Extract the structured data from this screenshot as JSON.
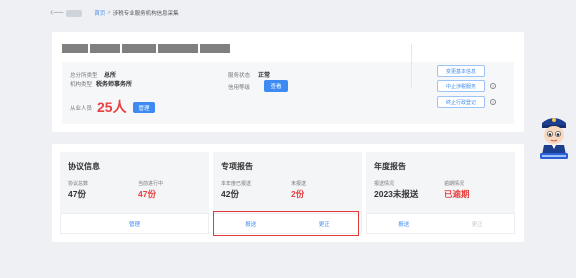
{
  "topbar": {
    "back_icon": "‹—",
    "breadcrumb_home": "首页",
    "breadcrumb_sep": ">",
    "breadcrumb_current": "涉税专业服务机构信息采集"
  },
  "org": {
    "type_label": "总分所类型",
    "type_value": "总所",
    "kind_label": "机构类型",
    "kind_value": "税务师事务所",
    "staff_label": "从业人员",
    "staff_value": "25人",
    "manage_button": "管理",
    "service_status_label": "服务状态",
    "service_status_value": "正常",
    "credit_label": "信用等级",
    "view_button": "查看",
    "actions": [
      "变更基本信息",
      "中止涉税服务",
      "终止行政登记"
    ]
  },
  "panels": {
    "agreement": {
      "title": "协议信息",
      "total_label": "协议总数",
      "total_value": "47份",
      "ongoing_label": "当前进行中",
      "ongoing_value": "47份",
      "manage_button": "管理"
    },
    "report": {
      "title": "专项报告",
      "submitted_label": "本年度已报送",
      "submitted_value": "42份",
      "pending_label": "未报送",
      "pending_value": "2份",
      "submit_button": "报送",
      "correct_button": "更正"
    },
    "annual": {
      "title": "年度报告",
      "status_label": "报送情况",
      "status_value": "2023未报送",
      "overdue_label": "逾期情况",
      "overdue_value": "已逾期",
      "submit_button": "报送",
      "correct_button": "更正"
    }
  },
  "colors": {
    "accent": "#3d8bf2",
    "alert": "#e84040",
    "highlight_box": "#e23a3a"
  }
}
